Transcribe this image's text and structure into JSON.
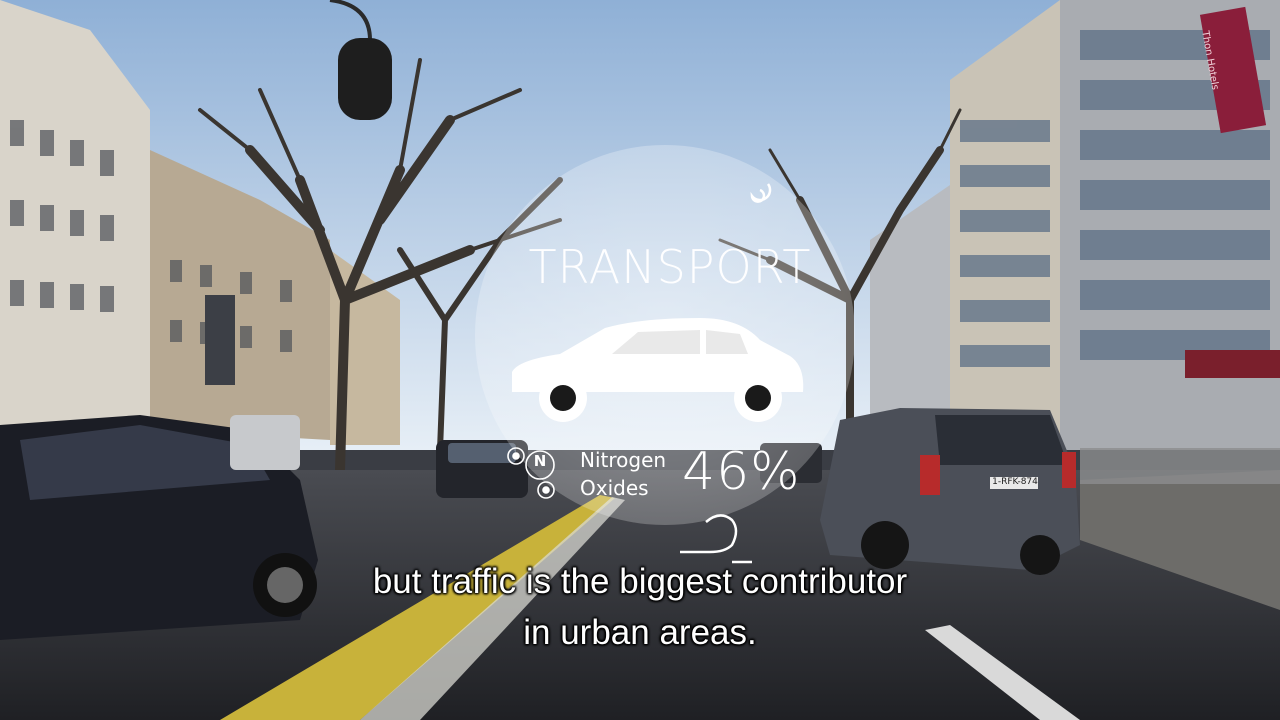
{
  "infographic": {
    "title": "TRANSPORT",
    "pollutant_line1": "Nitrogen",
    "pollutant_line2": "Oxides",
    "molecule_symbol": "N",
    "percentage": "46%",
    "car_icon": "car-icon",
    "spiral_icon": "spiral-icon"
  },
  "scene": {
    "license_plate": "1-RFK-874",
    "hotel_sign": "Thon Hotels"
  },
  "subtitles": {
    "line1": "but traffic is the biggest contributor",
    "line2": "in urban areas."
  },
  "colors": {
    "overlay_white": "#ffffff",
    "sky": "#b9cde3",
    "road": "#2c2e33",
    "curb_yellow": "#c8b23a"
  }
}
